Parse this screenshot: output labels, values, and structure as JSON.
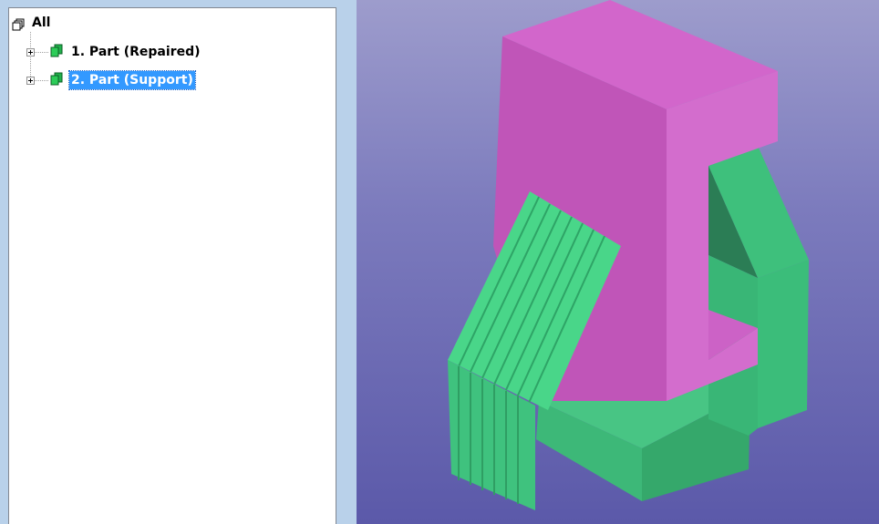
{
  "tree": {
    "root": {
      "label": "All",
      "icon": "parts-stack-icon"
    },
    "items": [
      {
        "label": "1. Part (Repaired)",
        "icon": "part-icon",
        "selected": false
      },
      {
        "label": "2. Part (Support)",
        "icon": "part-icon",
        "selected": true
      }
    ]
  },
  "viewport": {
    "colors": {
      "part": "#d065c8",
      "support": "#3fc07f",
      "background_top": "#9d9ccc",
      "background_bottom": "#5b59a9"
    }
  }
}
